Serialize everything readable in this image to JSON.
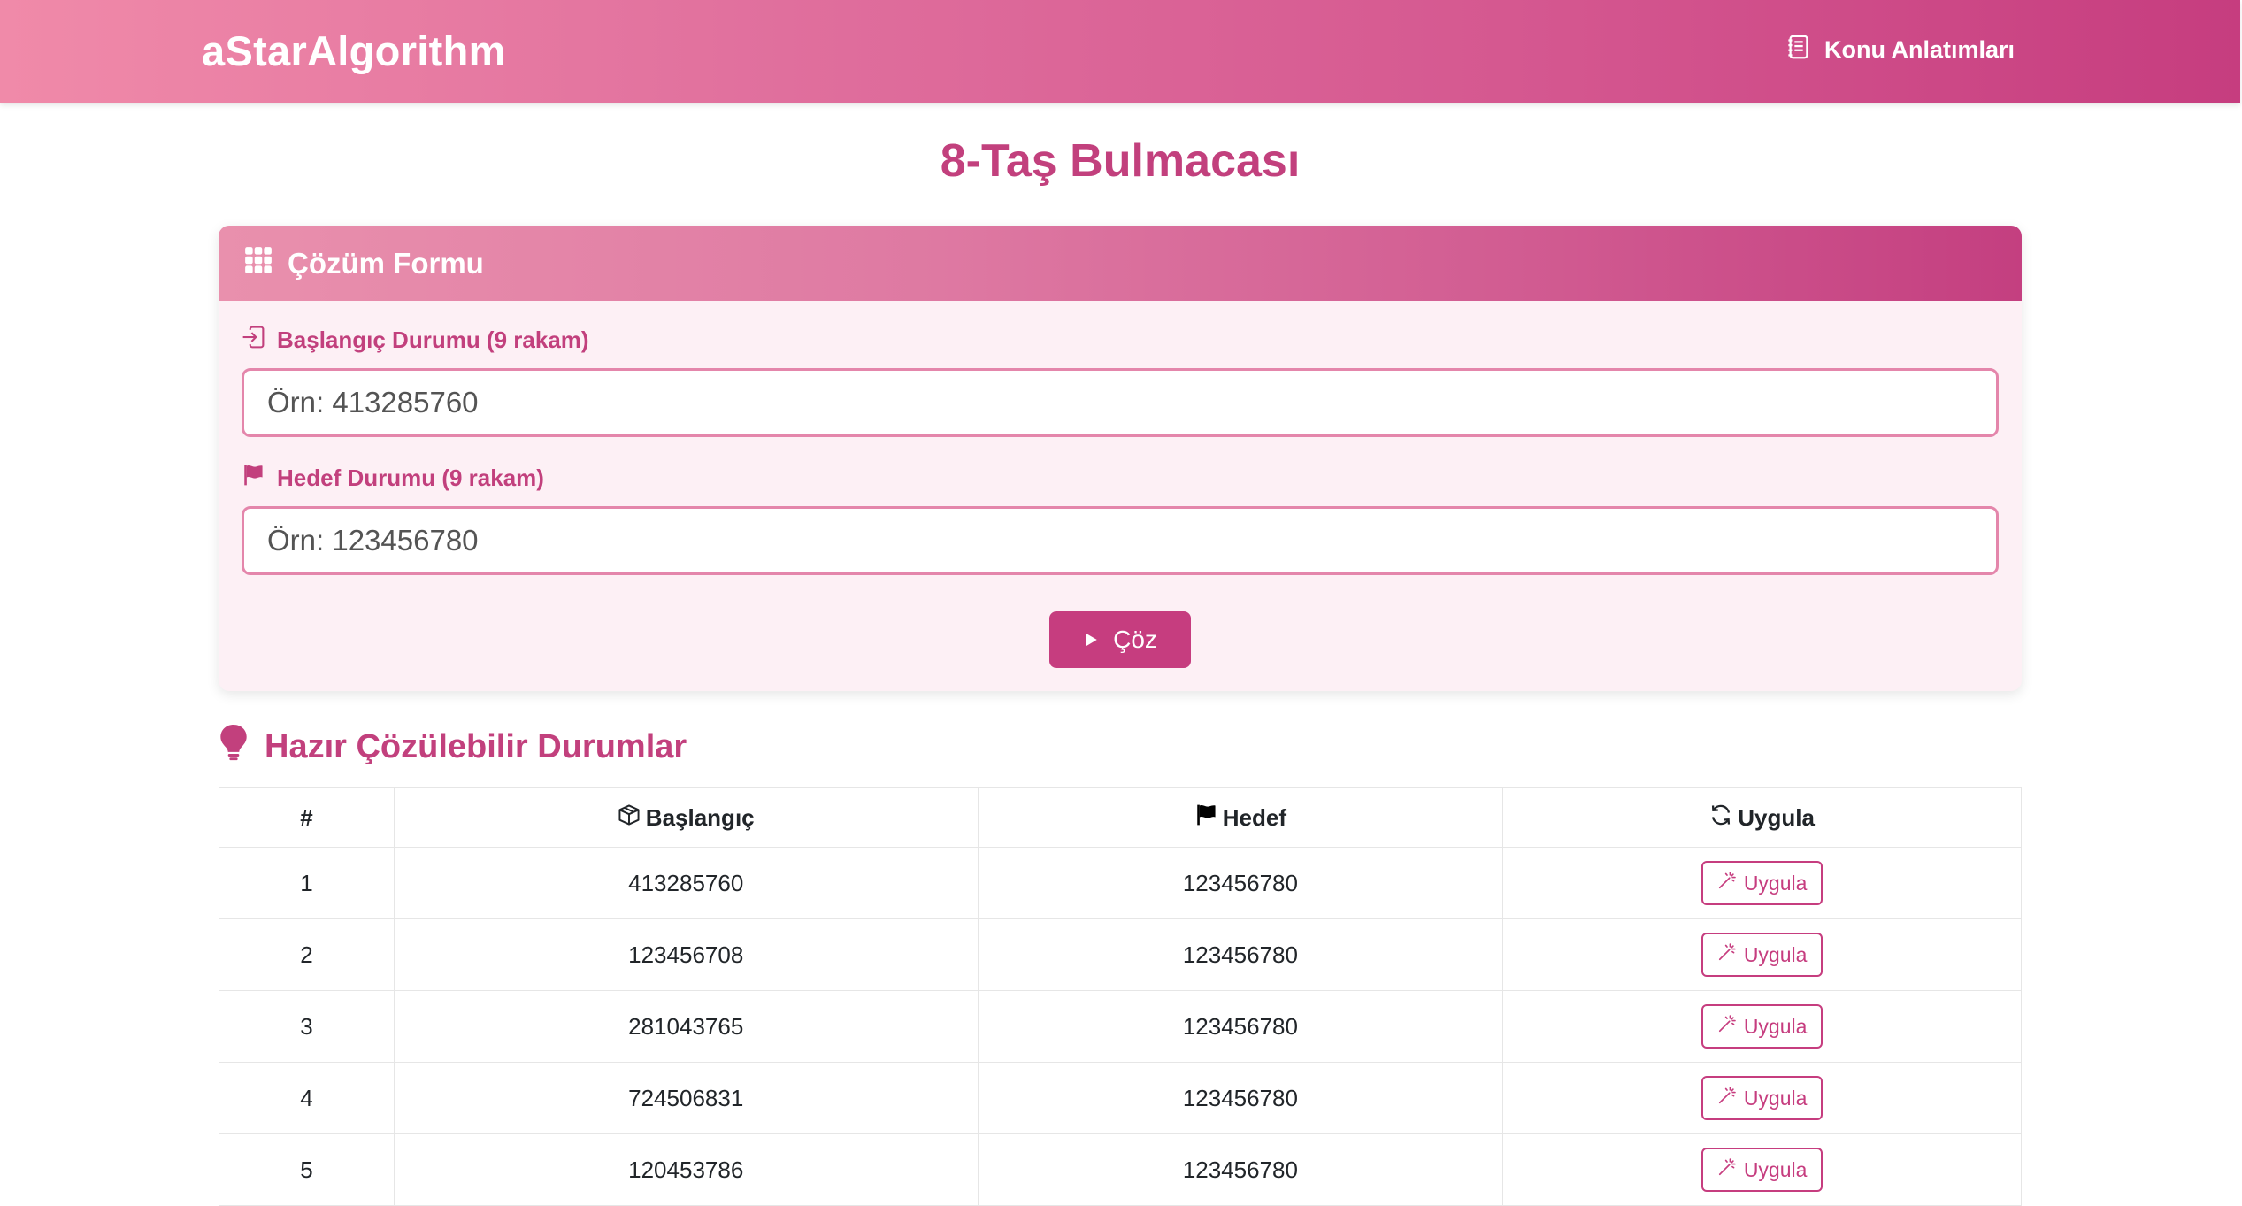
{
  "navbar": {
    "brand": "aStarAlgorithm",
    "link_label": "Konu Anlatımları",
    "link_icon": "journal-icon"
  },
  "page": {
    "title": "8-Taş Bulmacası"
  },
  "form": {
    "header": "Çözüm Formu",
    "header_icon": "grid-icon",
    "start_label": "Başlangıç Durumu (9 rakam)",
    "start_icon": "sign-in-icon",
    "start_placeholder": "Örn: 413285760",
    "start_value": "",
    "goal_label": "Hedef Durumu (9 rakam)",
    "goal_icon": "flag-icon",
    "goal_placeholder": "Örn: 123456780",
    "goal_value": "",
    "solve_label": "Çöz",
    "solve_icon": "play-icon"
  },
  "cases": {
    "title": "Hazır Çözülebilir Durumlar",
    "title_icon": "lightbulb-icon",
    "columns": {
      "index": "#",
      "start": "Başlangıç",
      "goal": "Hedef",
      "apply": "Uygula"
    },
    "apply_button_label": "Uygula",
    "rows": [
      {
        "index": "1",
        "start": "413285760",
        "goal": "123456780"
      },
      {
        "index": "2",
        "start": "123456708",
        "goal": "123456780"
      },
      {
        "index": "3",
        "start": "281043765",
        "goal": "123456780"
      },
      {
        "index": "4",
        "start": "724506831",
        "goal": "123456780"
      },
      {
        "index": "5",
        "start": "120453786",
        "goal": "123456780"
      }
    ]
  },
  "colors": {
    "accent": "#c63d7f",
    "accent_text": "#c2407d",
    "card_bg": "#fdf0f5",
    "input_border": "#e486ab"
  }
}
